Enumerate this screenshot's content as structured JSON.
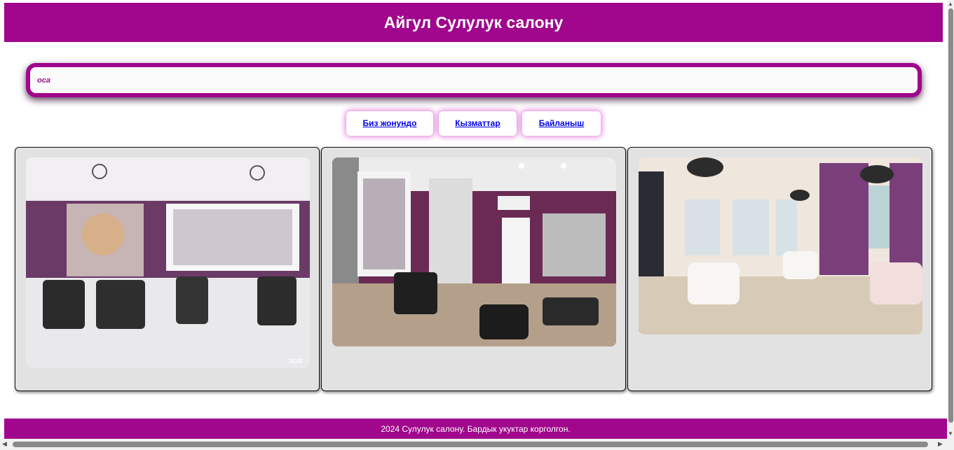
{
  "header": {
    "title": "Айгул Сулулук салону"
  },
  "banner": {
    "text": "оса"
  },
  "nav": {
    "items": [
      {
        "label": "Биз жонундо"
      },
      {
        "label": "Кызматтар"
      },
      {
        "label": "Байланыш"
      }
    ]
  },
  "gallery": {
    "photos": [
      {
        "subject": "salon-interior-purple-walls-chandeliers",
        "watermark": "2GIS"
      },
      {
        "subject": "salon-interior-mirror-lights"
      },
      {
        "subject": "salon-interior-white-chairs-curtains"
      }
    ]
  },
  "footer": {
    "text": "2024 Сулулук салону. Бардык укуктар корголгон."
  },
  "colors": {
    "brand": "#a0078c",
    "link": "#0000ee",
    "card_bg": "#e2e2e2"
  }
}
